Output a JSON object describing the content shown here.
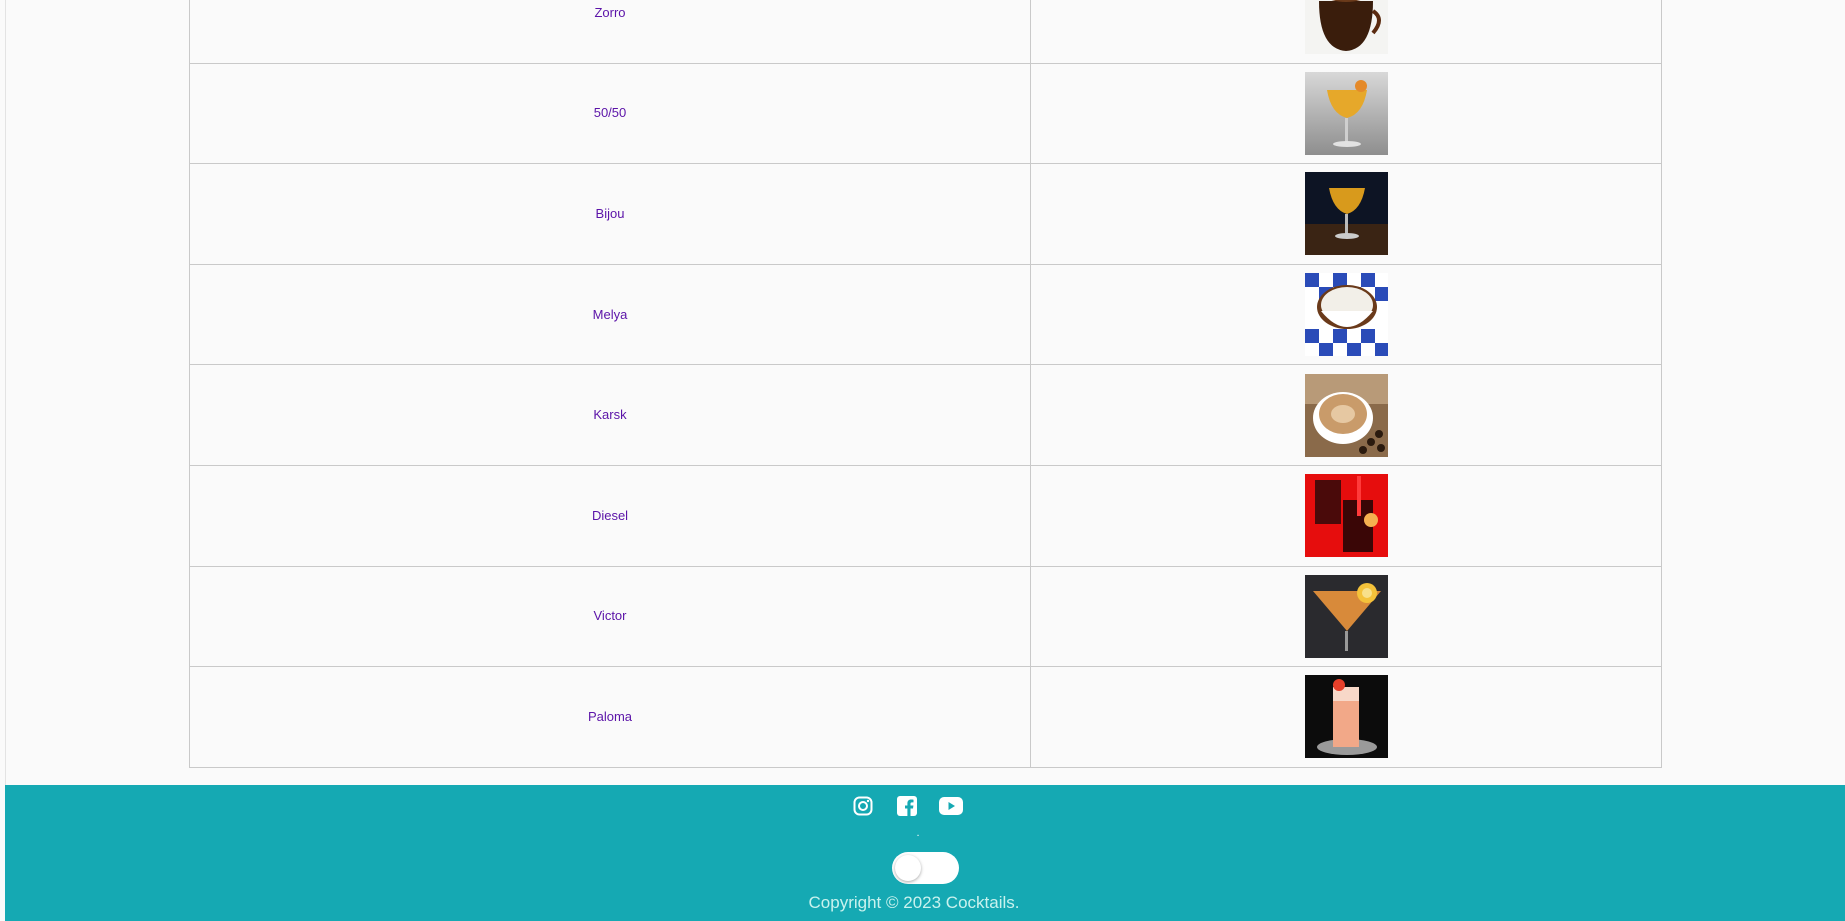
{
  "table": {
    "rows": [
      {
        "name": "Zorro",
        "image_icon": "drink-image-zorro"
      },
      {
        "name": "50/50",
        "image_icon": "drink-image-50-50"
      },
      {
        "name": "Bijou",
        "image_icon": "drink-image-bijou"
      },
      {
        "name": "Melya",
        "image_icon": "drink-image-melya"
      },
      {
        "name": "Karsk",
        "image_icon": "drink-image-karsk"
      },
      {
        "name": "Diesel",
        "image_icon": "drink-image-diesel"
      },
      {
        "name": "Victor",
        "image_icon": "drink-image-victor"
      },
      {
        "name": "Paloma",
        "image_icon": "drink-image-paloma"
      }
    ]
  },
  "footer": {
    "social_icons": [
      "instagram-icon",
      "facebook-icon",
      "youtube-icon"
    ],
    "dot": ".",
    "theme_toggle_on": false,
    "copyright": "Copyright © 2023 Cocktails."
  },
  "colors": {
    "link": "#5b13a8",
    "footer_bg": "#15a9b3",
    "copyright_text": "#c9f2ee",
    "page_bg": "#fafafa"
  }
}
